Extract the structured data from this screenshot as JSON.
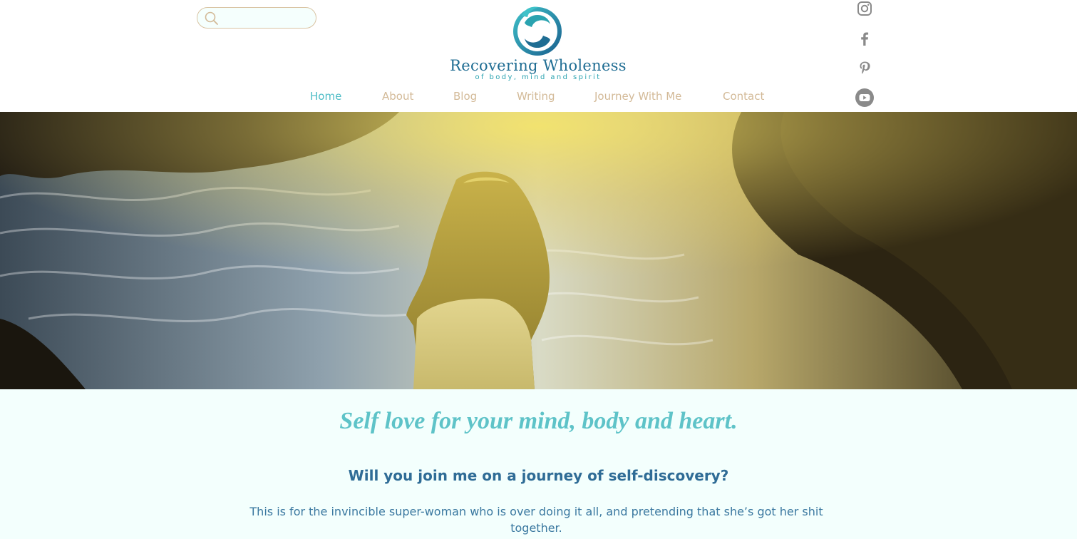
{
  "search": {
    "placeholder": "",
    "value": ""
  },
  "logo": {
    "brand": "Recovering Wholeness",
    "tagline": "of body, mind and spirit",
    "colors": {
      "primary": "#1f6d93",
      "accent": "#2aa3b0"
    }
  },
  "nav": {
    "items": [
      {
        "label": "Home",
        "active": true
      },
      {
        "label": "About",
        "active": false
      },
      {
        "label": "Blog",
        "active": false
      },
      {
        "label": "Writing",
        "active": false
      },
      {
        "label": "Journey With Me",
        "active": false
      },
      {
        "label": "Contact",
        "active": false
      }
    ],
    "colors": {
      "default": "#d3ba98",
      "active": "#4fbdc7"
    }
  },
  "social": {
    "icons": [
      "instagram-icon",
      "facebook-icon",
      "pinterest-icon",
      "youtube-icon"
    ],
    "color": "#8a8a8a"
  },
  "hero": {
    "image": "woman-at-sunlit-sea-rocks"
  },
  "content": {
    "headline": "Self love for your mind, body and heart.",
    "subhead": "Will you join me on a journey of self-discovery?",
    "body": "This is for the invincible super-woman who is over doing it all, and pretending that she’s got her shit together.",
    "background": "#f3fffd"
  }
}
